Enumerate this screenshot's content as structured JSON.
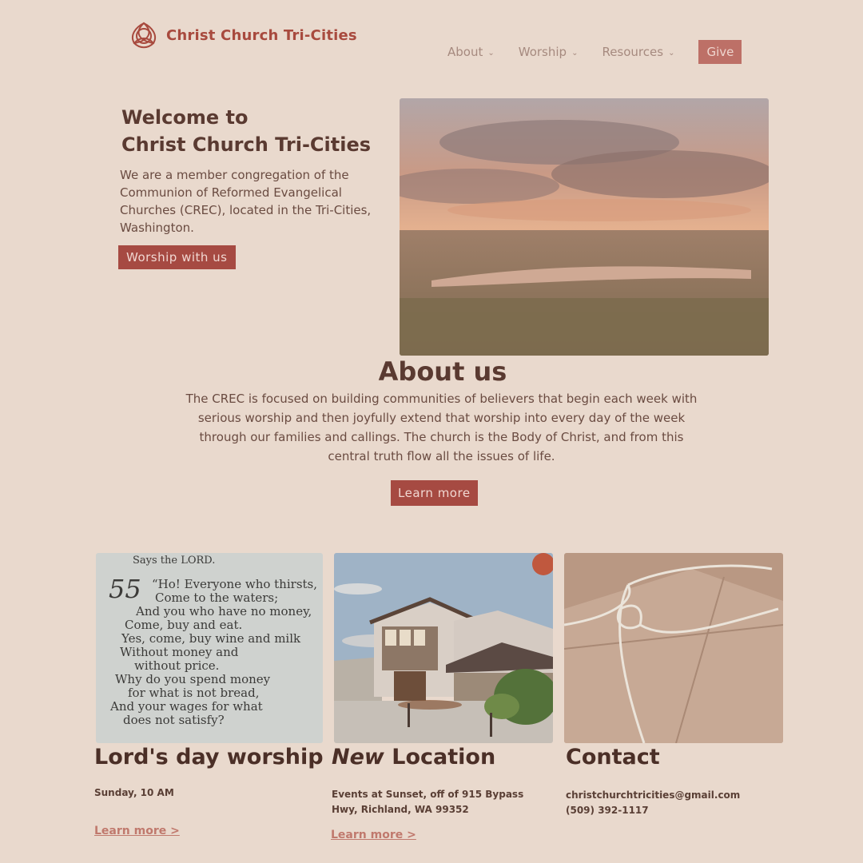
{
  "header": {
    "site_name": "Christ Church Tri-Cities",
    "nav": [
      {
        "label": "About",
        "has_dropdown": true
      },
      {
        "label": "Worship",
        "has_dropdown": true
      },
      {
        "label": "Resources",
        "has_dropdown": true
      }
    ],
    "give_label": "Give"
  },
  "hero": {
    "title_line1": "Welcome to",
    "title_line2": "Christ Church Tri-Cities",
    "text": "We are a member congregation of the Communion of Reformed Evangelical Churches (CREC), located in the Tri-Cities, Washington.",
    "button_label": "Worship with us"
  },
  "about": {
    "title": "About us",
    "text": "The CREC is focused on building communities of believers that begin each week with serious worship and then joyfully extend that worship into every day of the week through our families and callings. The church is the Body of Christ, and from this central truth flow all the issues of life.",
    "button_label": "Learn more"
  },
  "cards": [
    {
      "title": "Lord's day worship",
      "lines": [
        "Sunday, 10 AM"
      ],
      "link": "Learn more >",
      "scripture": {
        "heading": "Says the LORD.",
        "chapter": "55",
        "lines": [
          "“Ho! Everyone who thirsts,",
          "Come to the waters;",
          "And you who have no money,",
          "Come, buy and eat.",
          "Yes, come, buy wine and milk",
          "Without money and",
          "without price.",
          "Why do you spend money",
          "for what is not bread,",
          "And your wages for what",
          "does not satisfy?"
        ]
      }
    },
    {
      "title_em": "New",
      "title": "Location",
      "lines": [
        "Events at Sunset, off of 915 Bypass",
        "Hwy, Richland, WA 99352"
      ],
      "link": "Learn more >"
    },
    {
      "title": "Contact",
      "lines": [
        "christchurchtricities@gmail.com",
        "(509) 392-1117"
      ]
    }
  ],
  "colors": {
    "background": "#e9d9cd",
    "accent": "#a64a42",
    "text": "#5a3a31"
  }
}
